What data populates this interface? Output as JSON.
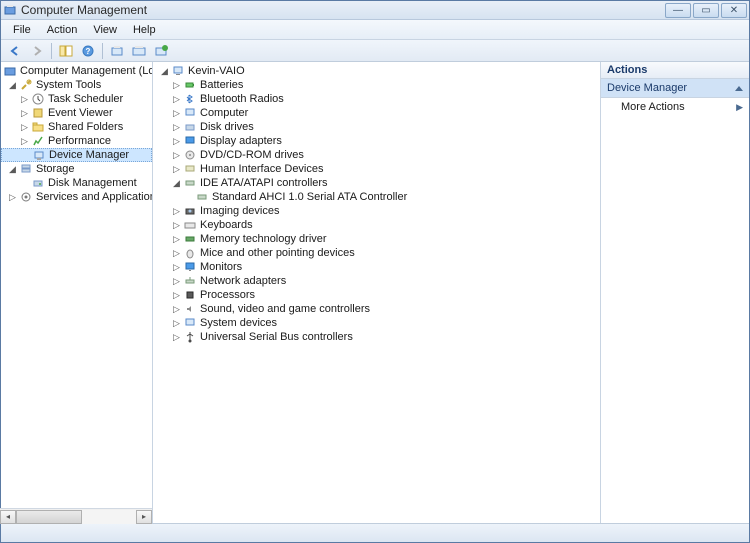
{
  "window": {
    "title": "Computer Management"
  },
  "menu": {
    "file": "File",
    "action": "Action",
    "view": "View",
    "help": "Help"
  },
  "actions": {
    "header": "Actions",
    "context": "Device Manager",
    "more": "More Actions"
  },
  "leftTree": {
    "root": "Computer Management (Local",
    "systemTools": "System Tools",
    "taskScheduler": "Task Scheduler",
    "eventViewer": "Event Viewer",
    "sharedFolders": "Shared Folders",
    "performance": "Performance",
    "deviceManager": "Device Manager",
    "storage": "Storage",
    "diskManagement": "Disk Management",
    "servicesApps": "Services and Applications"
  },
  "midTree": {
    "host": "Kevin-VAIO",
    "batteries": "Batteries",
    "bluetooth": "Bluetooth Radios",
    "computer": "Computer",
    "diskDrives": "Disk drives",
    "displayAdapters": "Display adapters",
    "dvd": "DVD/CD-ROM drives",
    "hid": "Human Interface Devices",
    "ide": "IDE ATA/ATAPI controllers",
    "ideChild": "Standard AHCI 1.0 Serial ATA Controller",
    "imaging": "Imaging devices",
    "keyboards": "Keyboards",
    "memtech": "Memory technology driver",
    "mice": "Mice and other pointing devices",
    "monitors": "Monitors",
    "network": "Network adapters",
    "processors": "Processors",
    "sound": "Sound, video and game controllers",
    "systemDevices": "System devices",
    "usb": "Universal Serial Bus controllers"
  }
}
